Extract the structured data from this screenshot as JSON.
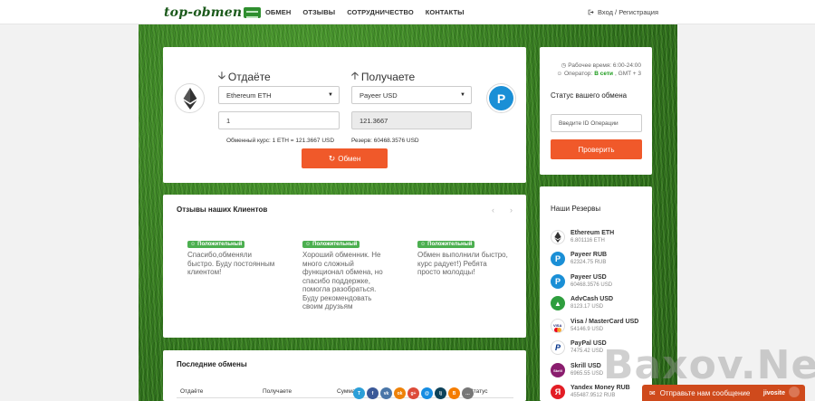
{
  "brand": {
    "logo_text": "top-obmen"
  },
  "nav": {
    "items": [
      "ОБМЕН",
      "ОТЗЫВЫ",
      "СОТРУДНИЧЕСТВО",
      "КОНТАКТЫ"
    ]
  },
  "auth": {
    "link_label": "Вход / Регистрация"
  },
  "exchange": {
    "give_title": "Отдаёте",
    "get_title": "Получаете",
    "give_currency": "Ethereum ETH",
    "get_currency": "Payeer USD",
    "give_amount": "1",
    "get_amount": "121.3667",
    "rate_label": "Обменный курс: 1 ETH = 121.3667 USD",
    "reserve_label": "Резерв: 60468.3576 USD",
    "button_label": "Обмен"
  },
  "status_panel": {
    "hours": "Рабочее время: 6:00-24:00",
    "operator_prefix": "Оператор:",
    "operator_status": "В сети",
    "operator_tz": ", GMT + 3",
    "title": "Статус вашего обмена",
    "input_placeholder": "Введите ID Операции",
    "button_label": "Проверить"
  },
  "reviews": {
    "title": "Отзывы наших Клиентов",
    "badge_label": "Положительный",
    "items": [
      {
        "text": "Спасибо,обменяли быстро. Буду постоянным клиентом!"
      },
      {
        "text": "Хороший обменник. Не много сложный функционал обмена, но спасибо поддержке, помогла разобраться. Буду рекомендовать своим друзьям"
      },
      {
        "text": "Обмен выполнили быстро, курс радует!) Ребята просто молодцы!"
      }
    ]
  },
  "reserves": {
    "title": "Наши Резервы",
    "items": [
      {
        "name": "Ethereum ETH",
        "amount": "6.801116 ETH",
        "icon": "ethereum-icon",
        "color": "#ffffff"
      },
      {
        "name": "Payeer RUB",
        "amount": "62324.75 RUB",
        "icon": "payeer-icon",
        "color": "#1a8fd6"
      },
      {
        "name": "Payeer USD",
        "amount": "60468.3576 USD",
        "icon": "payeer-icon",
        "color": "#1a8fd6"
      },
      {
        "name": "AdvCash USD",
        "amount": "8123.17 USD",
        "icon": "advcash-icon",
        "color": "#2e9e3e"
      },
      {
        "name": "Visa / MasterCard USD",
        "amount": "54146.9 USD",
        "icon": "visa-mastercard-icon",
        "color": "#ffffff"
      },
      {
        "name": "PayPal USD",
        "amount": "7475.42 USD",
        "icon": "paypal-icon",
        "color": "#ffffff"
      },
      {
        "name": "Skrill USD",
        "amount": "6965.55 USD",
        "icon": "skrill-icon",
        "color": "#8a1d6e"
      },
      {
        "name": "Yandex Money RUB",
        "amount": "455487.9512 RUB",
        "icon": "yandex-money-icon",
        "color": "#e31d25"
      }
    ]
  },
  "recent": {
    "title": "Последние обмены",
    "columns": [
      "Отдаёте",
      "Получаете",
      "Сумма",
      "Статус"
    ]
  },
  "share": {
    "services": [
      "telegram",
      "facebook",
      "vkontakte",
      "odnoklassniki",
      "google-plus",
      "mail-ru",
      "livejournal",
      "blogger",
      "more"
    ],
    "colors": [
      "#2c9fd8",
      "#3b5998",
      "#4a76a8",
      "#ee8208",
      "#dd4b39",
      "#168de2",
      "#0d425a",
      "#f57d00",
      "#777777"
    ],
    "glyphs": [
      "T",
      "f",
      "vk",
      "ok",
      "g+",
      "@",
      "lj",
      "B",
      "…"
    ]
  },
  "watermark": {
    "text": "Baxov.Net"
  },
  "chat": {
    "label": "Отправьте нам сообщение",
    "brand": "jivosite"
  }
}
